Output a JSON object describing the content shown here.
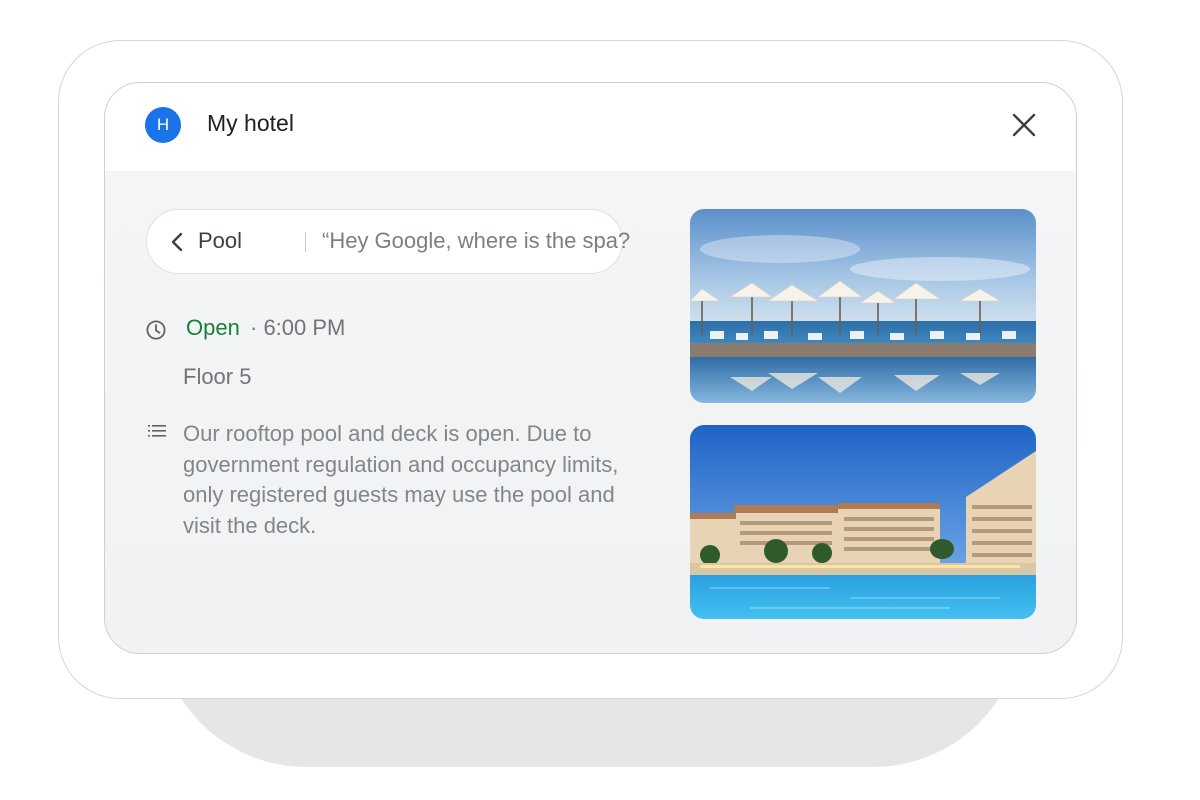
{
  "header": {
    "avatar_letter": "H",
    "title": "My hotel",
    "close_icon": "close-icon"
  },
  "chip": {
    "back_icon": "chevron-left-icon",
    "title": "Pool",
    "hint": "“Hey Google, where is the spa?"
  },
  "details": {
    "clock_icon": "clock-icon",
    "status": "Open",
    "hours": "· 6:00 PM",
    "floor": "Floor 5",
    "list_icon": "notes-icon",
    "description": "Our rooftop pool and deck is open. Due to government regulation and occupancy limits, only registered guests may use the pool and visit the deck."
  },
  "photos": [
    {
      "subject": "rooftop pool deck with white umbrellas by the sea"
    },
    {
      "subject": "resort hotel buildings around a large blue pool"
    }
  ],
  "colors": {
    "accent_blue": "#1a73e8",
    "open_green": "#188038",
    "secondary_text": "#70757a",
    "screen_bg": "#f3f4f5"
  }
}
